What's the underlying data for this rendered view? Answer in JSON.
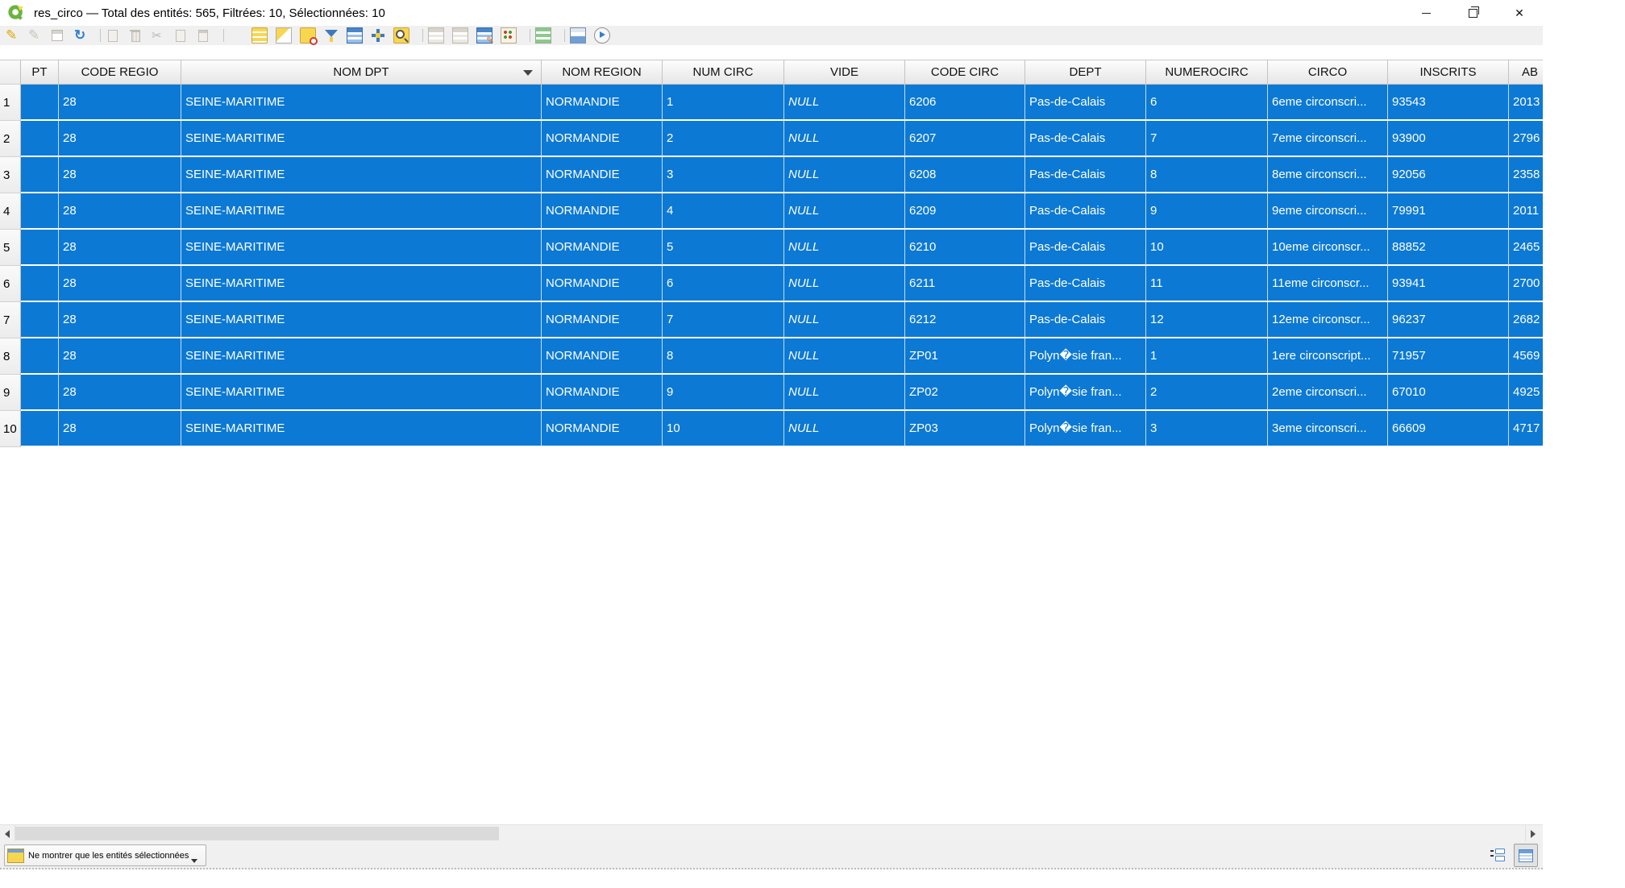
{
  "colors": {
    "selection_blue": "#0c79d4",
    "toolbar_bg": "#f0f0f0",
    "header_gradient_top": "#fdfdfd",
    "header_gradient_bottom": "#e6e6e6"
  },
  "window": {
    "title": "res_circo — Total des entités: 565, Filtrées: 10, Sélectionnées: 10",
    "controls": [
      "minimize-icon",
      "restore-icon",
      "close-icon"
    ]
  },
  "toolbar": {
    "items": [
      "toggle-editing-icon",
      "multiedit-icon",
      "save-edits-icon",
      "reload-icon",
      "|",
      "add-feature-icon",
      "delete-selected-icon",
      "cut-icon",
      "copy-icon",
      "paste-icon",
      "|",
      "select-by-expression-icon",
      "select-all-icon",
      "invert-selection-icon",
      "deselect-all-icon",
      "filter-icon",
      "move-selection-top-icon",
      "pan-to-selection-icon",
      "zoom-to-selection-icon",
      "|",
      "new-field-icon",
      "delete-field-icon",
      "field-calculator-icon",
      "abacus-icon",
      "|",
      "conditional-formatting-icon",
      "|",
      "dock-table-icon",
      "actions-icon"
    ]
  },
  "table": {
    "columns": [
      "PT",
      "CODE REGIO",
      "NOM DPT",
      "NOM REGION",
      "NUM CIRC",
      "VIDE",
      "CODE CIRC",
      "DEPT",
      "NUMEROCIRC",
      "CIRCO",
      "INSCRITS",
      "AB"
    ],
    "sorted_column": "NOM DPT",
    "sort_direction": "desc",
    "row_numbers": [
      "1",
      "2",
      "3",
      "4",
      "5",
      "6",
      "7",
      "8",
      "9",
      "10"
    ],
    "all_rows_selected": true,
    "rows": [
      [
        "",
        "28",
        "SEINE-MARITIME",
        "NORMANDIE",
        "1",
        "NULL",
        "6206",
        "Pas-de-Calais",
        "6",
        "6eme circonscri...",
        "93543",
        "2013"
      ],
      [
        "",
        "28",
        "SEINE-MARITIME",
        "NORMANDIE",
        "2",
        "NULL",
        "6207",
        "Pas-de-Calais",
        "7",
        "7eme circonscri...",
        "93900",
        "2796"
      ],
      [
        "",
        "28",
        "SEINE-MARITIME",
        "NORMANDIE",
        "3",
        "NULL",
        "6208",
        "Pas-de-Calais",
        "8",
        "8eme circonscri...",
        "92056",
        "2358"
      ],
      [
        "",
        "28",
        "SEINE-MARITIME",
        "NORMANDIE",
        "4",
        "NULL",
        "6209",
        "Pas-de-Calais",
        "9",
        "9eme circonscri...",
        "79991",
        "2011"
      ],
      [
        "",
        "28",
        "SEINE-MARITIME",
        "NORMANDIE",
        "5",
        "NULL",
        "6210",
        "Pas-de-Calais",
        "10",
        "10eme circonscr...",
        "88852",
        "2465"
      ],
      [
        "",
        "28",
        "SEINE-MARITIME",
        "NORMANDIE",
        "6",
        "NULL",
        "6211",
        "Pas-de-Calais",
        "11",
        "11eme circonscr...",
        "93941",
        "2700"
      ],
      [
        "",
        "28",
        "SEINE-MARITIME",
        "NORMANDIE",
        "7",
        "NULL",
        "6212",
        "Pas-de-Calais",
        "12",
        "12eme circonscr...",
        "96237",
        "2682"
      ],
      [
        "",
        "28",
        "SEINE-MARITIME",
        "NORMANDIE",
        "8",
        "NULL",
        "ZP01",
        "Polyn�sie fran...",
        "1",
        "1ere circonscript...",
        "71957",
        "4569"
      ],
      [
        "",
        "28",
        "SEINE-MARITIME",
        "NORMANDIE",
        "9",
        "NULL",
        "ZP02",
        "Polyn�sie fran...",
        "2",
        "2eme circonscri...",
        "67010",
        "4925"
      ],
      [
        "",
        "28",
        "SEINE-MARITIME",
        "NORMANDIE",
        "10",
        "NULL",
        "ZP03",
        "Polyn�sie fran...",
        "3",
        "3eme circonscri...",
        "66609",
        "4717"
      ]
    ]
  },
  "statusbar": {
    "filter_button_label": "Ne montrer que les entités sélectionnées",
    "view_toggles": [
      "form-view-icon",
      "table-view-icon"
    ],
    "active_view": "table-view"
  }
}
